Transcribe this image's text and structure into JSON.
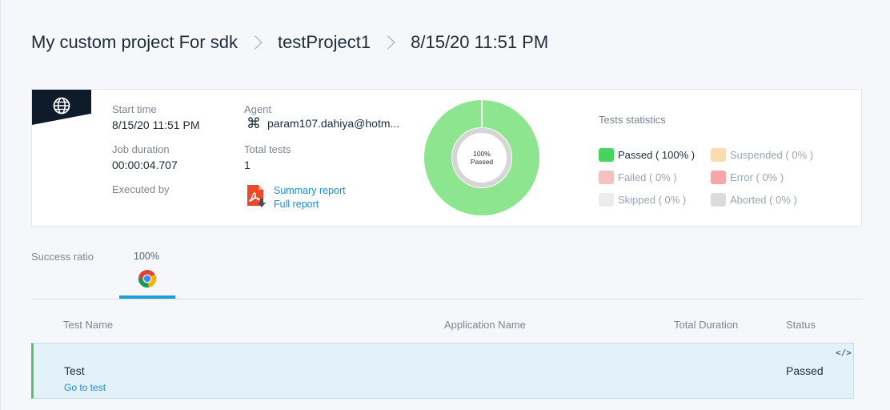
{
  "breadcrumb": {
    "project": "My custom project For sdk",
    "test_project": "testProject1",
    "run": "8/15/20 11:51 PM"
  },
  "summary": {
    "platform_icon": "globe-icon",
    "start_time_label": "Start time",
    "start_time_value": "8/15/20 11:51 PM",
    "job_duration_label": "Job duration",
    "job_duration_value": "00:00:04.707",
    "executed_by_label": "Executed by",
    "agent_label": "Agent",
    "agent_icon": "command-icon",
    "agent_value": "param107.dahiya@hotm...",
    "total_tests_label": "Total tests",
    "total_tests_value": "1",
    "report_icon": "pdf-download-icon",
    "summary_report": "Summary report",
    "full_report": "Full report"
  },
  "donut": {
    "center_percent": "100%",
    "center_label": "Passed",
    "passed_fraction": 1.0,
    "passed_color": "#8ee590",
    "inner_ring_color": "#d6d6d6"
  },
  "stats": {
    "title": "Tests statistics",
    "items": [
      {
        "label": "Passed ( 100% )",
        "color": "#46d35e",
        "text_color": "#1d2b3a"
      },
      {
        "label": "Suspended ( 0% )",
        "color": "#fbdcae",
        "text_color": "#9aa5b1"
      },
      {
        "label": "Failed ( 0% )",
        "color": "#f6c1c1",
        "text_color": "#9aa5b1"
      },
      {
        "label": "Error ( 0% )",
        "color": "#f4a7a7",
        "text_color": "#9aa5b1"
      },
      {
        "label": "Skipped ( 0% )",
        "color": "#ececec",
        "text_color": "#9aa5b1"
      },
      {
        "label": "Aborted ( 0% )",
        "color": "#dcdcdc",
        "text_color": "#9aa5b1"
      }
    ]
  },
  "success_ratio": {
    "label": "Success ratio",
    "value": "100%",
    "browser_icon": "chrome-icon"
  },
  "table": {
    "columns": {
      "test_name": "Test Name",
      "application_name": "Application Name",
      "total_duration": "Total Duration",
      "status": "Status"
    },
    "rows": [
      {
        "name": "Test",
        "link": "Go to test",
        "status": "Passed",
        "code_icon": "code-icon",
        "code_glyph": "</>"
      }
    ]
  }
}
